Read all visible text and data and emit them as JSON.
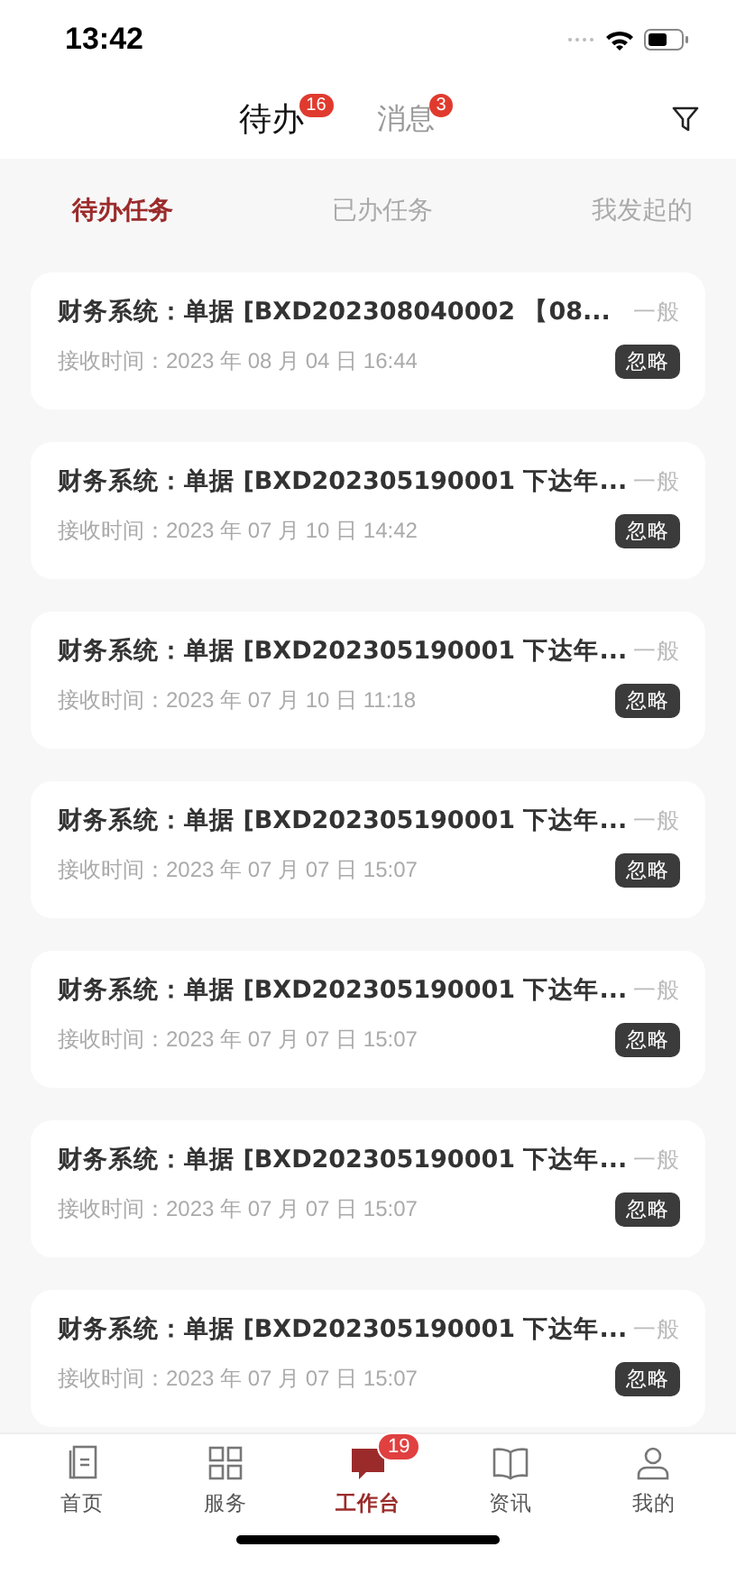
{
  "status_bar": {
    "time": "13:42"
  },
  "header_tabs": [
    {
      "label": "待办",
      "badge": "16",
      "selected": true
    },
    {
      "label": "消息",
      "badge": "3",
      "selected": false
    }
  ],
  "sub_tabs": [
    {
      "label": "待办任务",
      "selected": true
    },
    {
      "label": "已办任务",
      "selected": false
    },
    {
      "label": "我发起的",
      "selected": false
    }
  ],
  "tasks": [
    {
      "title": "财务系统：单据 [BXD202308040002 【08...",
      "priority": "一般",
      "received": "接收时间：2023 年 08 月 04 日 16:44",
      "action": "忽略"
    },
    {
      "title": "财务系统：单据 [BXD202305190001 下达年...",
      "priority": "一般",
      "received": "接收时间：2023 年 07 月 10 日 14:42",
      "action": "忽略"
    },
    {
      "title": "财务系统：单据 [BXD202305190001 下达年...",
      "priority": "一般",
      "received": "接收时间：2023 年 07 月 10 日 11:18",
      "action": "忽略"
    },
    {
      "title": "财务系统：单据 [BXD202305190001 下达年...",
      "priority": "一般",
      "received": "接收时间：2023 年 07 月 07 日 15:07",
      "action": "忽略"
    },
    {
      "title": "财务系统：单据 [BXD202305190001 下达年...",
      "priority": "一般",
      "received": "接收时间：2023 年 07 月 07 日 15:07",
      "action": "忽略"
    },
    {
      "title": "财务系统：单据 [BXD202305190001 下达年...",
      "priority": "一般",
      "received": "接收时间：2023 年 07 月 07 日 15:07",
      "action": "忽略"
    },
    {
      "title": "财务系统：单据 [BXD202305190001 下达年...",
      "priority": "一般",
      "received": "接收时间：2023 年 07 月 07 日 15:07",
      "action": "忽略"
    }
  ],
  "bottom_nav": [
    {
      "label": "首页",
      "kind": "home",
      "selected": false
    },
    {
      "label": "服务",
      "kind": "grid",
      "selected": false
    },
    {
      "label": "工作台",
      "kind": "chat",
      "badge": "19",
      "selected": true
    },
    {
      "label": "资讯",
      "kind": "book",
      "selected": false
    },
    {
      "label": "我的",
      "kind": "person",
      "selected": false
    }
  ]
}
